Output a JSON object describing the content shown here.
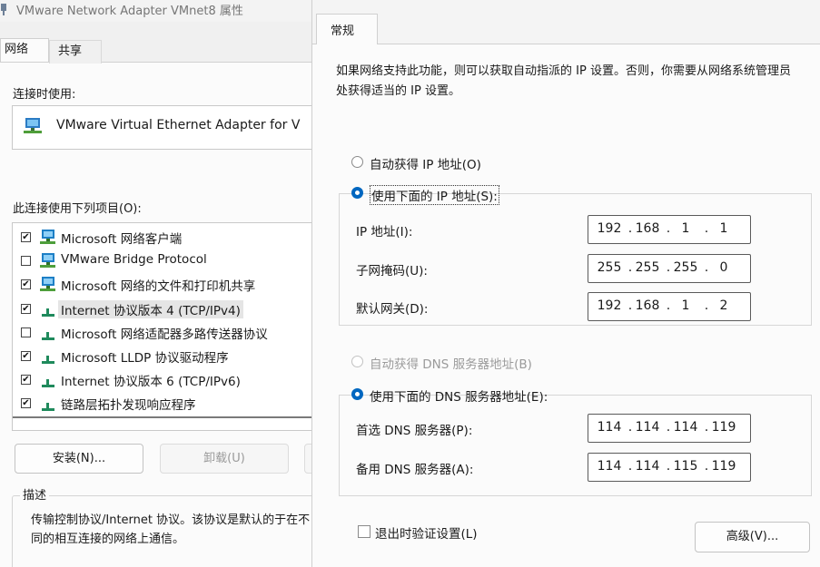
{
  "back_window": {
    "title": "VMware Network Adapter VMnet8 属性",
    "tabs": [
      "网络",
      "共享"
    ],
    "connect_using_label": "连接时使用:",
    "adapter_name": "VMware Virtual Ethernet Adapter for V",
    "items_label": "此连接使用下列项目(O):",
    "items": [
      {
        "checked": true,
        "label": "Microsoft 网络客户端",
        "icon": "network-client-icon"
      },
      {
        "checked": false,
        "label": "VMware Bridge Protocol",
        "icon": "network-client-icon"
      },
      {
        "checked": true,
        "label": "Microsoft 网络的文件和打印机共享",
        "icon": "network-client-icon"
      },
      {
        "checked": true,
        "label": "Internet 协议版本 4 (TCP/IPv4)",
        "icon": "protocol-icon",
        "selected": true
      },
      {
        "checked": false,
        "label": "Microsoft 网络适配器多路传送器协议",
        "icon": "protocol-icon"
      },
      {
        "checked": true,
        "label": "Microsoft LLDP 协议驱动程序",
        "icon": "protocol-icon"
      },
      {
        "checked": true,
        "label": "Internet 协议版本 6 (TCP/IPv6)",
        "icon": "protocol-icon"
      },
      {
        "checked": true,
        "label": "链路层拓扑发现响应程序",
        "icon": "protocol-icon"
      }
    ],
    "install_label": "安装(N)...",
    "uninstall_label": "卸载(U)",
    "description_title": "描述",
    "description_text": "传输控制协议/Internet 协议。该协议是默认的于在不同的相互连接的网络上通信。"
  },
  "front_window": {
    "tab": "常规",
    "intro": "如果网络支持此功能，则可以获取自动指派的 IP 设置。否则，你需要从网络系统管理员处获得适当的 IP 设置。",
    "ip_auto_label": "自动获得 IP 地址(O)",
    "ip_manual_label": "使用下面的 IP 地址(S):",
    "ip_fields": [
      {
        "label": "IP 地址(I):",
        "value": [
          "192",
          "168",
          "1",
          "1"
        ]
      },
      {
        "label": "子网掩码(U):",
        "value": [
          "255",
          "255",
          "255",
          "0"
        ]
      },
      {
        "label": "默认网关(D):",
        "value": [
          "192",
          "168",
          "1",
          "2"
        ]
      }
    ],
    "dns_auto_label": "自动获得 DNS 服务器地址(B)",
    "dns_manual_label": "使用下面的 DNS 服务器地址(E):",
    "dns_fields": [
      {
        "label": "首选 DNS 服务器(P):",
        "value": [
          "114",
          "114",
          "114",
          "119"
        ]
      },
      {
        "label": "备用 DNS 服务器(A):",
        "value": [
          "114",
          "114",
          "115",
          "119"
        ]
      }
    ],
    "validate_label": "退出时验证设置(L)",
    "validate_checked": false,
    "advanced_label": "高级(V)..."
  },
  "colors": {
    "accent": "#0067c0",
    "client_icon": "#1d7fc6",
    "protocol_icon": "#1f8a5c"
  }
}
